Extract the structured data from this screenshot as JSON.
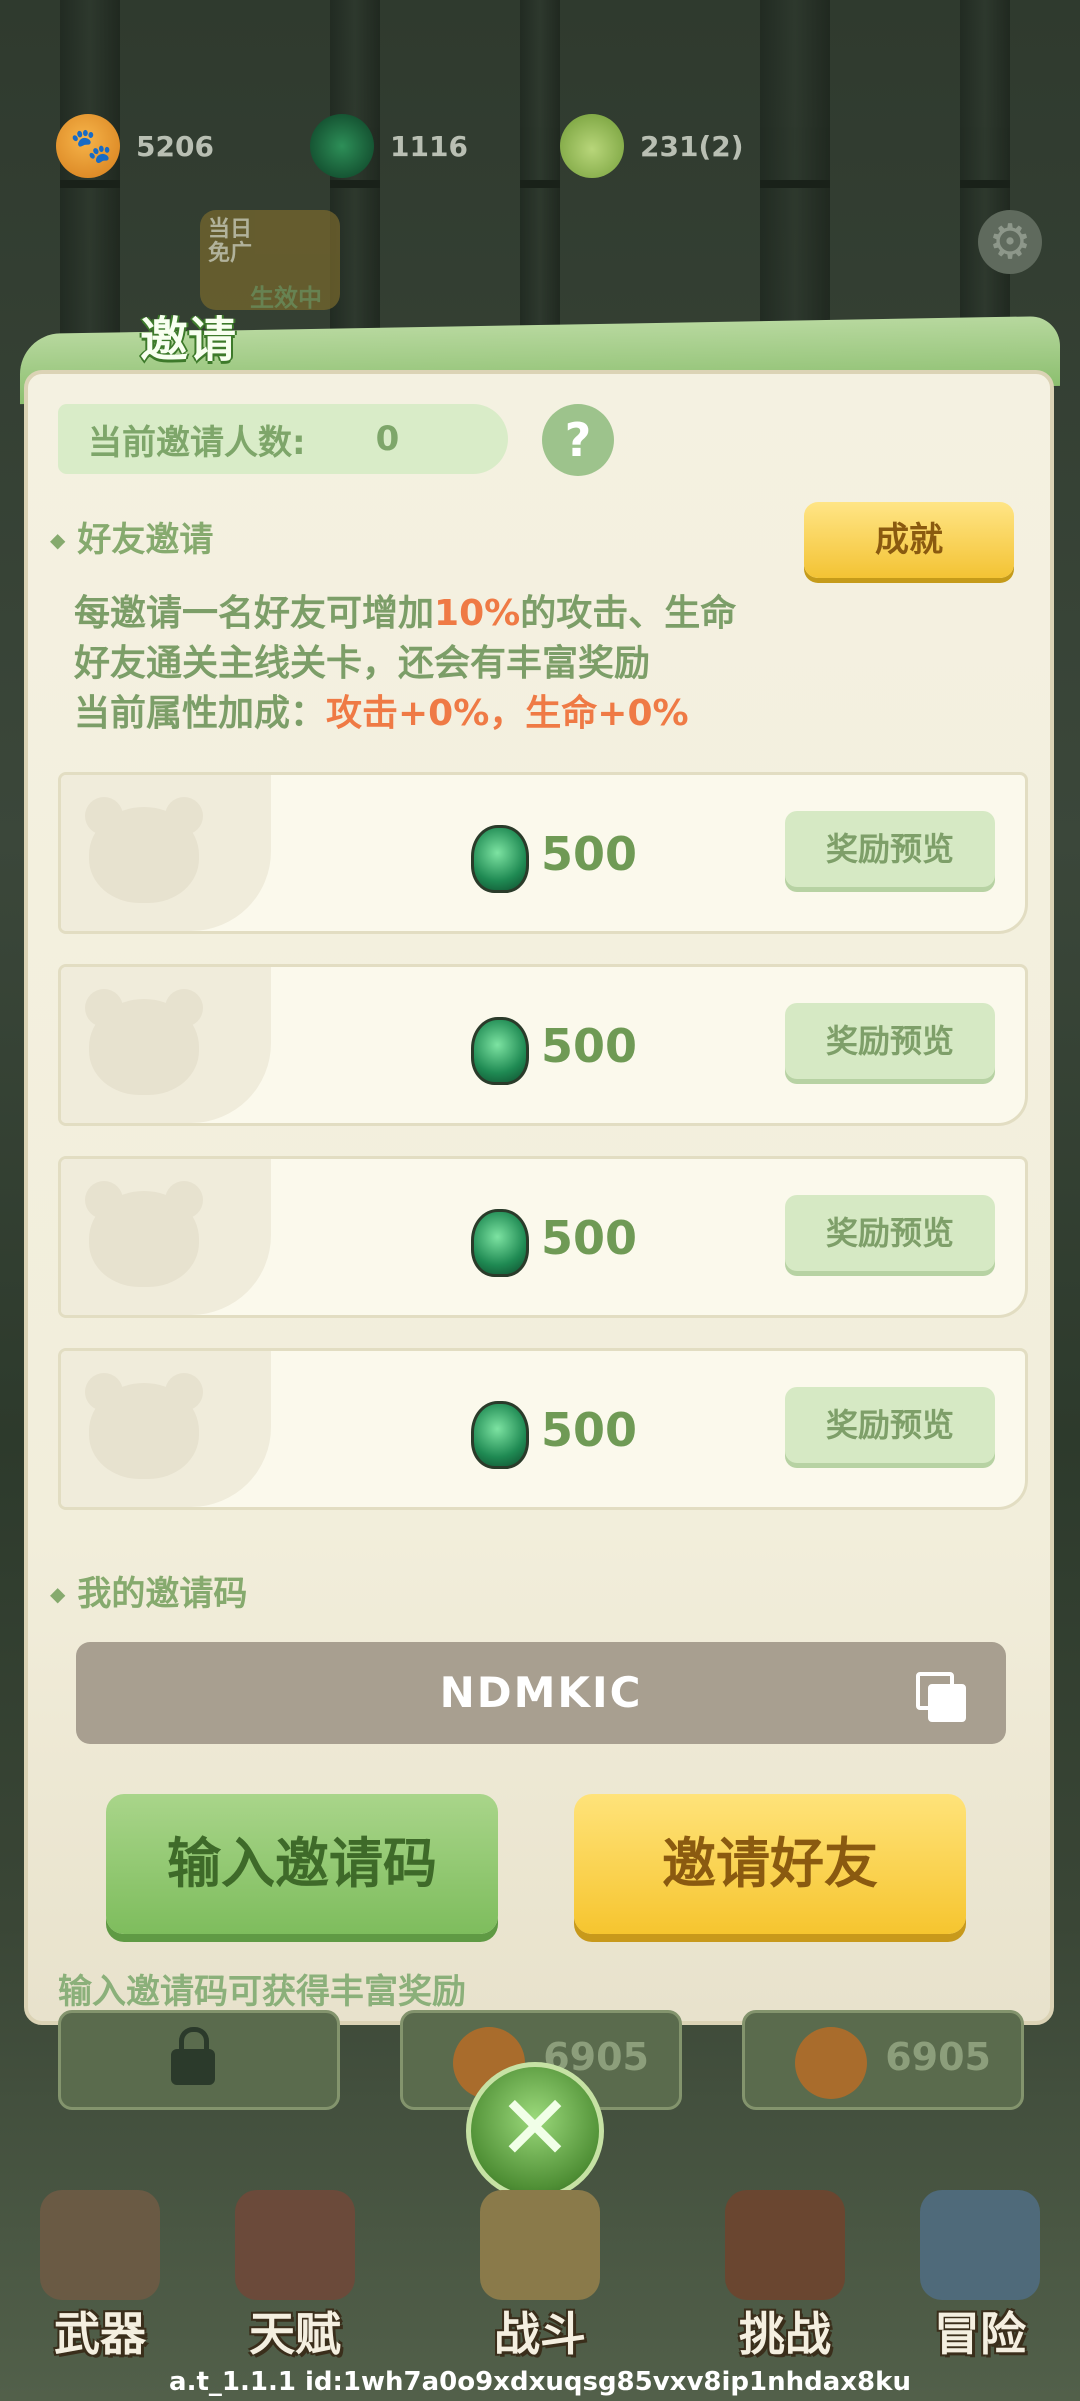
{
  "currencies": [
    {
      "icon": "paw-coin-icon",
      "value": "5206"
    },
    {
      "icon": "green-gem-icon",
      "value": "1116"
    },
    {
      "icon": "bamboo-shoot-icon",
      "value": "231(2)"
    }
  ],
  "daily_badge": {
    "line1": "当日",
    "line2": "免广",
    "status": "生效中"
  },
  "modal": {
    "title": "邀请",
    "invite_count_label": "当前邀请人数:",
    "invite_count": "0",
    "help_label": "?",
    "section_friend": "好友邀请",
    "achievement_button": "成就",
    "desc_line1_a": "每邀请一名好友可增加",
    "desc_line1_hl": "10%",
    "desc_line1_b": "的攻击、生命",
    "desc_line2": "好友通关主线关卡，还会有丰富奖励",
    "desc_line3_a": "当前属性加成：",
    "desc_line3_hl": "攻击+0%，生命+0%",
    "rewards": [
      {
        "amount": "500",
        "button": "奖励预览"
      },
      {
        "amount": "500",
        "button": "奖励预览"
      },
      {
        "amount": "500",
        "button": "奖励预览"
      },
      {
        "amount": "500",
        "button": "奖励预览"
      }
    ],
    "section_code": "我的邀请码",
    "invite_code": "NDMKIC",
    "enter_code_button": "输入邀请码",
    "invite_friend_button": "邀请好友",
    "hint": "输入邀请码可获得丰富奖励"
  },
  "bottom_slots": [
    {
      "type": "locked",
      "value": ""
    },
    {
      "type": "paw",
      "value": "6905"
    },
    {
      "type": "paw",
      "value": "6905"
    }
  ],
  "nav": [
    {
      "label": "武器",
      "icon": "axe-icon",
      "color": "#6a5a44"
    },
    {
      "label": "天赋",
      "icon": "book-icon",
      "color": "#6b4a3a"
    },
    {
      "label": "战斗",
      "icon": "scroll-icon",
      "color": "#8a7a4a"
    },
    {
      "label": "挑战",
      "icon": "stump-icon",
      "color": "#6a4630"
    },
    {
      "label": "冒险",
      "icon": "map-icon",
      "color": "#4f6a7a"
    }
  ],
  "footer": "a.t_1.1.1 id:1wh7a0o9xdxuqsg85vxv8ip1nhdax8ku"
}
